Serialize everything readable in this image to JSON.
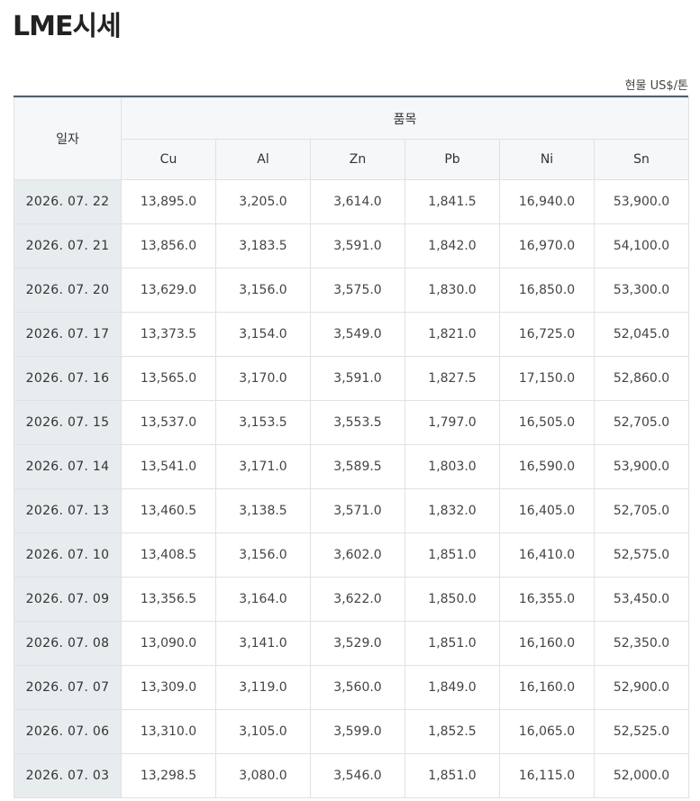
{
  "page": {
    "title": "LME시세",
    "unit": "현물 US$/톤"
  },
  "table": {
    "date_header": "일자",
    "group_header": "품목",
    "columns": [
      "Cu",
      "Al",
      "Zn",
      "Pb",
      "Ni",
      "Sn"
    ],
    "rows": [
      {
        "date": "2026. 07. 22",
        "values": [
          "13,895.0",
          "3,205.0",
          "3,614.0",
          "1,841.5",
          "16,940.0",
          "53,900.0"
        ]
      },
      {
        "date": "2026. 07. 21",
        "values": [
          "13,856.0",
          "3,183.5",
          "3,591.0",
          "1,842.0",
          "16,970.0",
          "54,100.0"
        ]
      },
      {
        "date": "2026. 07. 20",
        "values": [
          "13,629.0",
          "3,156.0",
          "3,575.0",
          "1,830.0",
          "16,850.0",
          "53,300.0"
        ]
      },
      {
        "date": "2026. 07. 17",
        "values": [
          "13,373.5",
          "3,154.0",
          "3,549.0",
          "1,821.0",
          "16,725.0",
          "52,045.0"
        ]
      },
      {
        "date": "2026. 07. 16",
        "values": [
          "13,565.0",
          "3,170.0",
          "3,591.0",
          "1,827.5",
          "17,150.0",
          "52,860.0"
        ]
      },
      {
        "date": "2026. 07. 15",
        "values": [
          "13,537.0",
          "3,153.5",
          "3,553.5",
          "1,797.0",
          "16,505.0",
          "52,705.0"
        ]
      },
      {
        "date": "2026. 07. 14",
        "values": [
          "13,541.0",
          "3,171.0",
          "3,589.5",
          "1,803.0",
          "16,590.0",
          "53,900.0"
        ]
      },
      {
        "date": "2026. 07. 13",
        "values": [
          "13,460.5",
          "3,138.5",
          "3,571.0",
          "1,832.0",
          "16,405.0",
          "52,705.0"
        ]
      },
      {
        "date": "2026. 07. 10",
        "values": [
          "13,408.5",
          "3,156.0",
          "3,602.0",
          "1,851.0",
          "16,410.0",
          "52,575.0"
        ]
      },
      {
        "date": "2026. 07. 09",
        "values": [
          "13,356.5",
          "3,164.0",
          "3,622.0",
          "1,850.0",
          "16,355.0",
          "53,450.0"
        ]
      },
      {
        "date": "2026. 07. 08",
        "values": [
          "13,090.0",
          "3,141.0",
          "3,529.0",
          "1,851.0",
          "16,160.0",
          "52,350.0"
        ]
      },
      {
        "date": "2026. 07. 07",
        "values": [
          "13,309.0",
          "3,119.0",
          "3,560.0",
          "1,849.0",
          "16,160.0",
          "52,900.0"
        ]
      },
      {
        "date": "2026. 07. 06",
        "values": [
          "13,310.0",
          "3,105.0",
          "3,599.0",
          "1,852.5",
          "16,065.0",
          "52,525.0"
        ]
      },
      {
        "date": "2026. 07. 03",
        "values": [
          "13,298.5",
          "3,080.0",
          "3,546.0",
          "1,851.0",
          "16,115.0",
          "52,000.0"
        ]
      }
    ]
  }
}
